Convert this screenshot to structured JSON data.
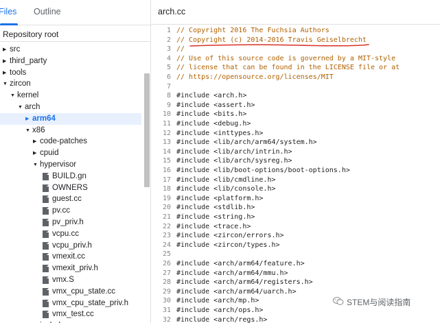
{
  "left_panel": {
    "tabs": [
      {
        "label": "Files"
      },
      {
        "label": "Outline"
      }
    ],
    "repo_root": "Repository root",
    "tree": [
      {
        "label": "src",
        "type": "folder",
        "expanded": false
      },
      {
        "label": "third_party",
        "type": "folder",
        "expanded": false
      },
      {
        "label": "tools",
        "type": "folder",
        "expanded": false
      },
      {
        "label": "zircon",
        "type": "folder",
        "expanded": true
      },
      {
        "label": "kernel",
        "type": "folder",
        "expanded": true
      },
      {
        "label": "arch",
        "type": "folder",
        "expanded": true
      },
      {
        "label": "arm64",
        "type": "folder",
        "expanded": false,
        "selected": true
      },
      {
        "label": "x86",
        "type": "folder",
        "expanded": true
      },
      {
        "label": "code-patches",
        "type": "folder",
        "expanded": false
      },
      {
        "label": "cpuid",
        "type": "folder",
        "expanded": false
      },
      {
        "label": "hypervisor",
        "type": "folder",
        "expanded": true
      },
      {
        "label": "BUILD.gn",
        "type": "file"
      },
      {
        "label": "OWNERS",
        "type": "file"
      },
      {
        "label": "guest.cc",
        "type": "file"
      },
      {
        "label": "pv.cc",
        "type": "file"
      },
      {
        "label": "pv_priv.h",
        "type": "file"
      },
      {
        "label": "vcpu.cc",
        "type": "file"
      },
      {
        "label": "vcpu_priv.h",
        "type": "file"
      },
      {
        "label": "vmexit.cc",
        "type": "file"
      },
      {
        "label": "vmexit_priv.h",
        "type": "file"
      },
      {
        "label": "vmx.S",
        "type": "file"
      },
      {
        "label": "vmx_cpu_state.cc",
        "type": "file"
      },
      {
        "label": "vmx_cpu_state_priv.h",
        "type": "file"
      },
      {
        "label": "vmx_test.cc",
        "type": "file"
      },
      {
        "label": "include",
        "type": "folder",
        "expanded": false
      }
    ]
  },
  "editor": {
    "file_name": "arch.cc",
    "lines": [
      {
        "n": "1",
        "text": "// Copyright 2016 The Fuchsia Authors",
        "kind": "comment"
      },
      {
        "n": "2",
        "text": "// Copyright (c) 2014-2016 Travis Geiselbrecht",
        "kind": "comment"
      },
      {
        "n": "3",
        "text": "//",
        "kind": "comment"
      },
      {
        "n": "4",
        "text": "// Use of this source code is governed by a MIT-style",
        "kind": "comment"
      },
      {
        "n": "5",
        "text": "// license that can be found in the LICENSE file or at",
        "kind": "comment"
      },
      {
        "n": "6",
        "text": "// https://opensource.org/licenses/MIT",
        "kind": "comment"
      },
      {
        "n": "7",
        "text": "",
        "kind": "code"
      },
      {
        "n": "8",
        "text": "#include <arch.h>",
        "kind": "code"
      },
      {
        "n": "9",
        "text": "#include <assert.h>",
        "kind": "code"
      },
      {
        "n": "10",
        "text": "#include <bits.h>",
        "kind": "code"
      },
      {
        "n": "11",
        "text": "#include <debug.h>",
        "kind": "code"
      },
      {
        "n": "12",
        "text": "#include <inttypes.h>",
        "kind": "code"
      },
      {
        "n": "13",
        "text": "#include <lib/arch/arm64/system.h>",
        "kind": "code"
      },
      {
        "n": "14",
        "text": "#include <lib/arch/intrin.h>",
        "kind": "code"
      },
      {
        "n": "15",
        "text": "#include <lib/arch/sysreg.h>",
        "kind": "code"
      },
      {
        "n": "16",
        "text": "#include <lib/boot-options/boot-options.h>",
        "kind": "code"
      },
      {
        "n": "17",
        "text": "#include <lib/cmdline.h>",
        "kind": "code"
      },
      {
        "n": "18",
        "text": "#include <lib/console.h>",
        "kind": "code"
      },
      {
        "n": "19",
        "text": "#include <platform.h>",
        "kind": "code"
      },
      {
        "n": "20",
        "text": "#include <stdlib.h>",
        "kind": "code"
      },
      {
        "n": "21",
        "text": "#include <string.h>",
        "kind": "code"
      },
      {
        "n": "22",
        "text": "#include <trace.h>",
        "kind": "code"
      },
      {
        "n": "23",
        "text": "#include <zircon/errors.h>",
        "kind": "code"
      },
      {
        "n": "24",
        "text": "#include <zircon/types.h>",
        "kind": "code"
      },
      {
        "n": "25",
        "text": "",
        "kind": "code"
      },
      {
        "n": "26",
        "text": "#include <arch/arm64/feature.h>",
        "kind": "code"
      },
      {
        "n": "27",
        "text": "#include <arch/arm64/mmu.h>",
        "kind": "code"
      },
      {
        "n": "28",
        "text": "#include <arch/arm64/registers.h>",
        "kind": "code"
      },
      {
        "n": "29",
        "text": "#include <arch/arm64/uarch.h>",
        "kind": "code"
      },
      {
        "n": "30",
        "text": "#include <arch/mp.h>",
        "kind": "code"
      },
      {
        "n": "31",
        "text": "#include <arch/ops.h>",
        "kind": "code"
      },
      {
        "n": "32",
        "text": "#include <arch/regs.h>",
        "kind": "code"
      }
    ]
  },
  "watermark": {
    "text": "STEM与阅读指南",
    "icon": "wechat-icon"
  },
  "colors": {
    "accent": "#1a73e8",
    "comment": "#b06000",
    "annotation": "#d93025"
  }
}
